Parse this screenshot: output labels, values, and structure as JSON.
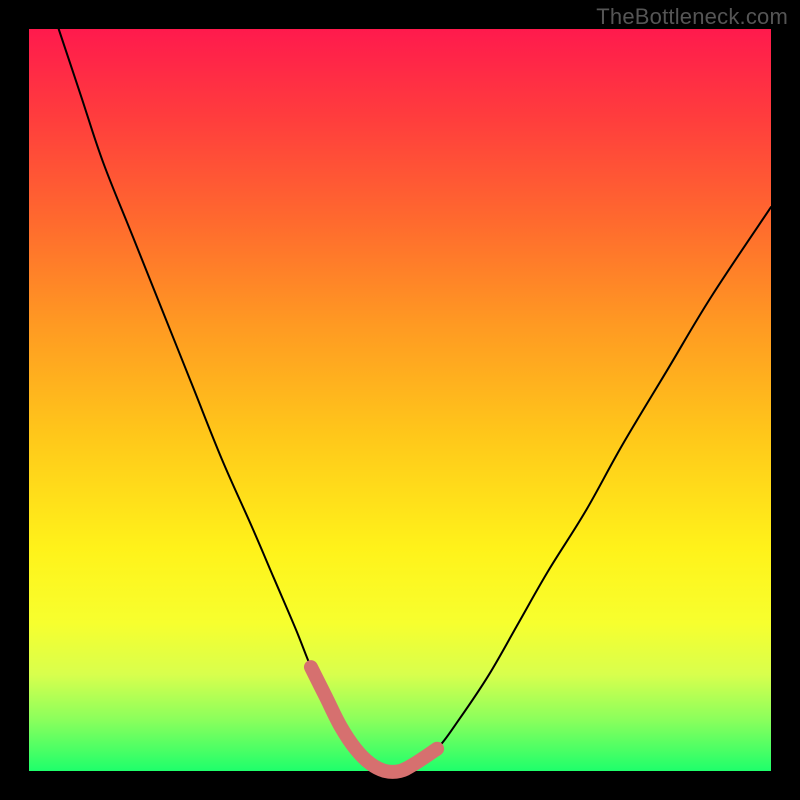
{
  "watermark": "TheBottleneck.com",
  "chart_data": {
    "type": "line",
    "title": "",
    "xlabel": "",
    "ylabel": "",
    "xlim": [
      0,
      100
    ],
    "ylim": [
      0,
      100
    ],
    "series": [
      {
        "name": "bottleneck-curve",
        "x": [
          4,
          7,
          10,
          14,
          18,
          22,
          26,
          30,
          33,
          36,
          38,
          40,
          42,
          44,
          46,
          48,
          50,
          52,
          55,
          58,
          62,
          66,
          70,
          75,
          80,
          86,
          92,
          100
        ],
        "values": [
          100,
          91,
          82,
          72,
          62,
          52,
          42,
          33,
          26,
          19,
          14,
          10,
          6,
          3,
          1,
          0,
          0,
          1,
          3,
          7,
          13,
          20,
          27,
          35,
          44,
          54,
          64,
          76
        ]
      }
    ],
    "highlight": {
      "name": "trough-marker",
      "color": "#d6706f",
      "x": [
        38,
        40,
        42,
        44,
        46,
        48,
        50,
        52,
        55
      ],
      "values": [
        14,
        10,
        6,
        3,
        1,
        0,
        0,
        1,
        3
      ]
    },
    "colors": {
      "curve": "#000000",
      "highlight": "#d6706f",
      "background_top": "#ff1a4d",
      "background_bottom": "#1eff6b",
      "frame": "#000000"
    }
  }
}
